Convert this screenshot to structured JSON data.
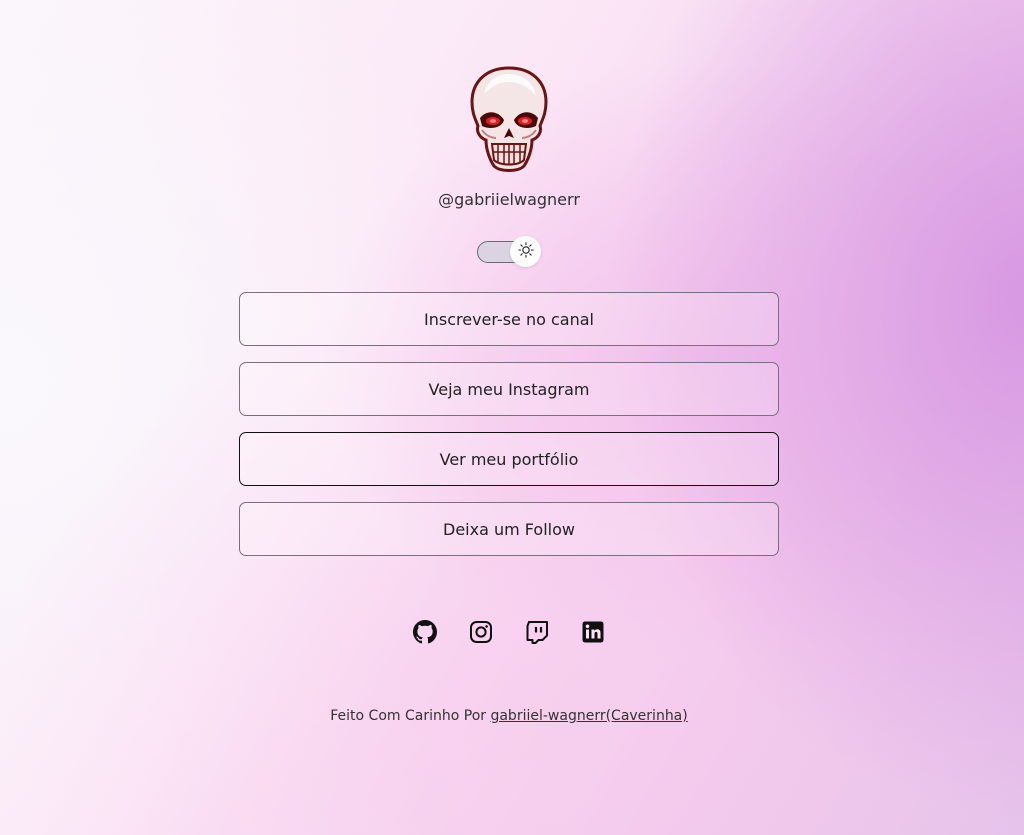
{
  "profile": {
    "username": "@gabriielwagnerr",
    "avatar_icon": "skull-icon"
  },
  "theme_toggle": {
    "icon": "sun-icon",
    "state": "light"
  },
  "links": [
    {
      "label": "Inscrever-se no canal"
    },
    {
      "label": "Veja meu Instagram"
    },
    {
      "label": "Ver meu portfólio"
    },
    {
      "label": "Deixa um Follow"
    }
  ],
  "socials": [
    {
      "icon": "github-icon"
    },
    {
      "icon": "instagram-icon"
    },
    {
      "icon": "twitch-icon"
    },
    {
      "icon": "linkedin-icon"
    }
  ],
  "footer": {
    "text": "Feito Com Carinho Por ",
    "author_link": "gabriiel-wagnerr(Caverinha)"
  },
  "colors": {
    "accent": "#d99ae4",
    "text": "#222222"
  }
}
